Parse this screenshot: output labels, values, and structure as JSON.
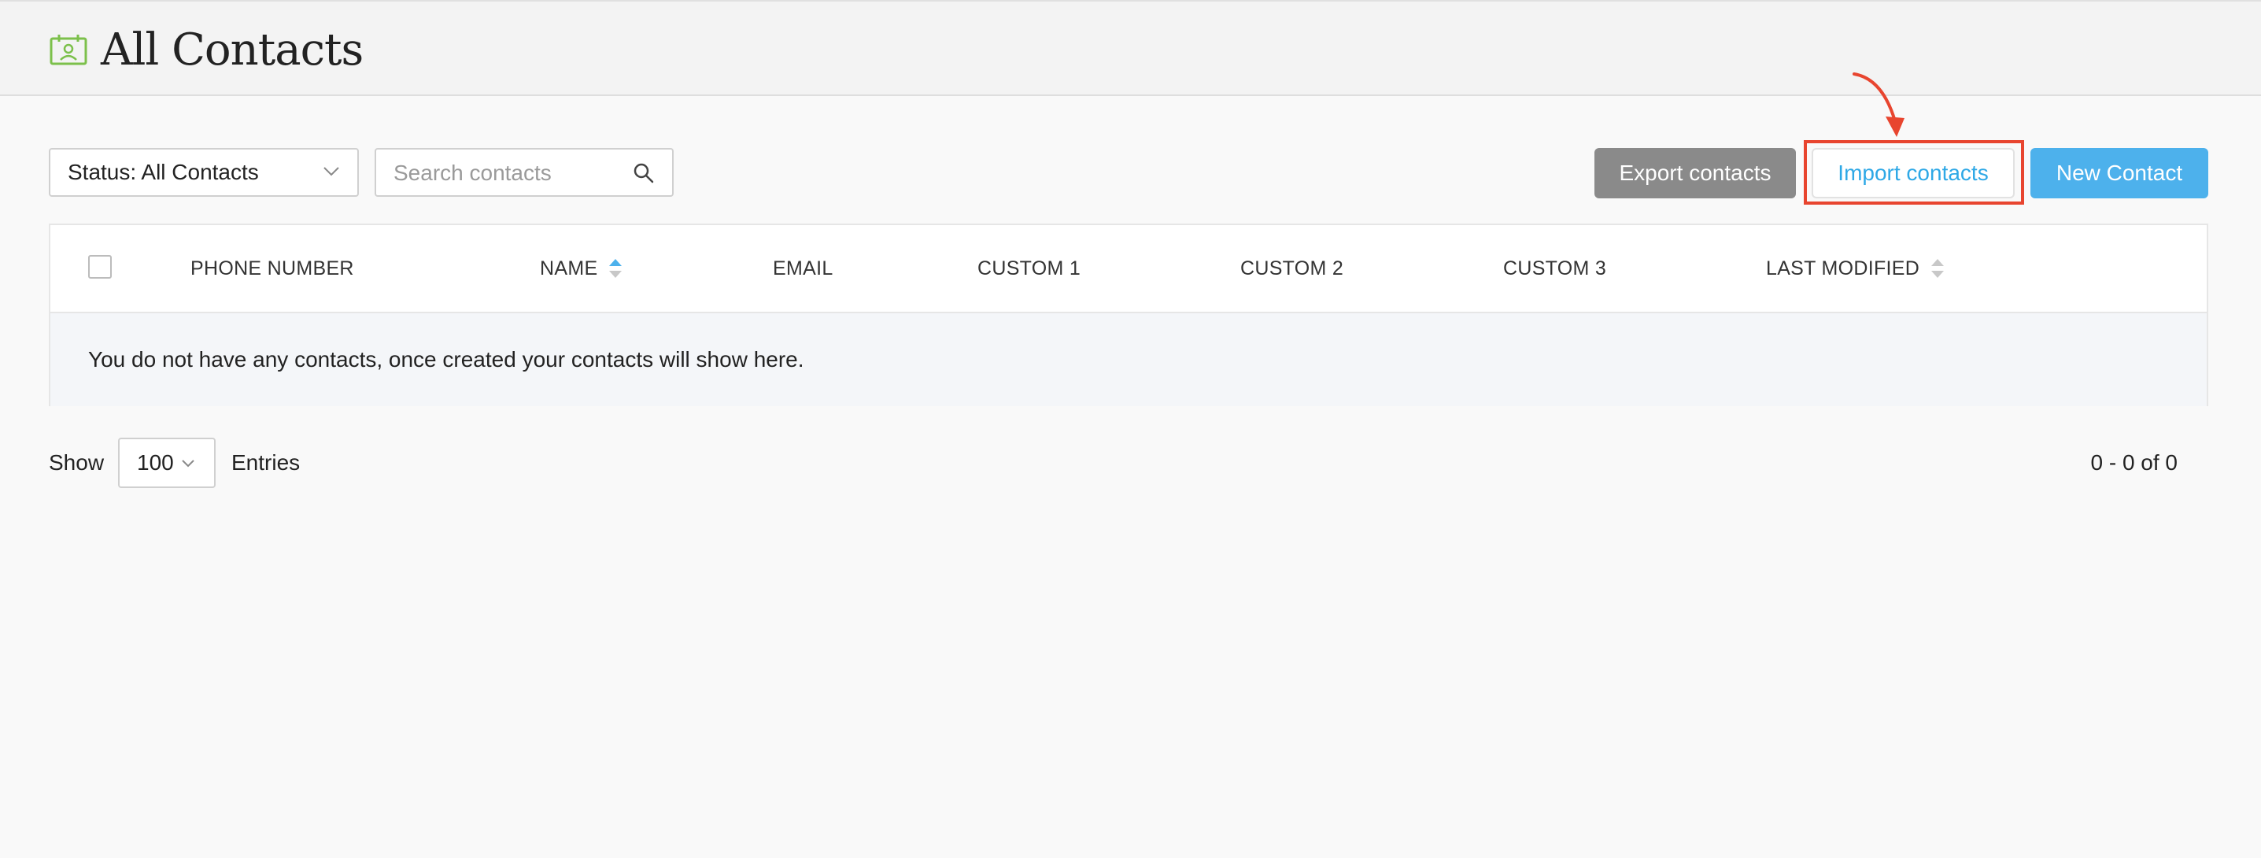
{
  "header": {
    "title": "All Contacts",
    "icon": "contacts-calendar-icon",
    "icon_color": "#7cc04b"
  },
  "toolbar": {
    "status_select": "Status: All Contacts",
    "search_placeholder": "Search contacts",
    "export_label": "Export contacts",
    "import_label": "Import contacts",
    "new_label": "New Contact"
  },
  "annotation": {
    "color": "#e8452f"
  },
  "table": {
    "columns": [
      {
        "label": "PHONE NUMBER",
        "sortable": false
      },
      {
        "label": "NAME",
        "sortable": true,
        "sort_state": "ascending"
      },
      {
        "label": "EMAIL",
        "sortable": false
      },
      {
        "label": "CUSTOM 1",
        "sortable": false
      },
      {
        "label": "CUSTOM 2",
        "sortable": false
      },
      {
        "label": "CUSTOM 3",
        "sortable": false
      },
      {
        "label": "LAST MODIFIED",
        "sortable": true,
        "sort_state": "none"
      }
    ],
    "empty_message": "You do not have any contacts, once created your contacts will show here."
  },
  "footer": {
    "show_label": "Show",
    "entries_value": "100",
    "entries_label": "Entries",
    "pagination": "0 - 0 of 0"
  },
  "colors": {
    "accent_blue": "#4db1ec",
    "link_blue": "#2ea8e6",
    "export_gray": "#8a8a8a"
  }
}
